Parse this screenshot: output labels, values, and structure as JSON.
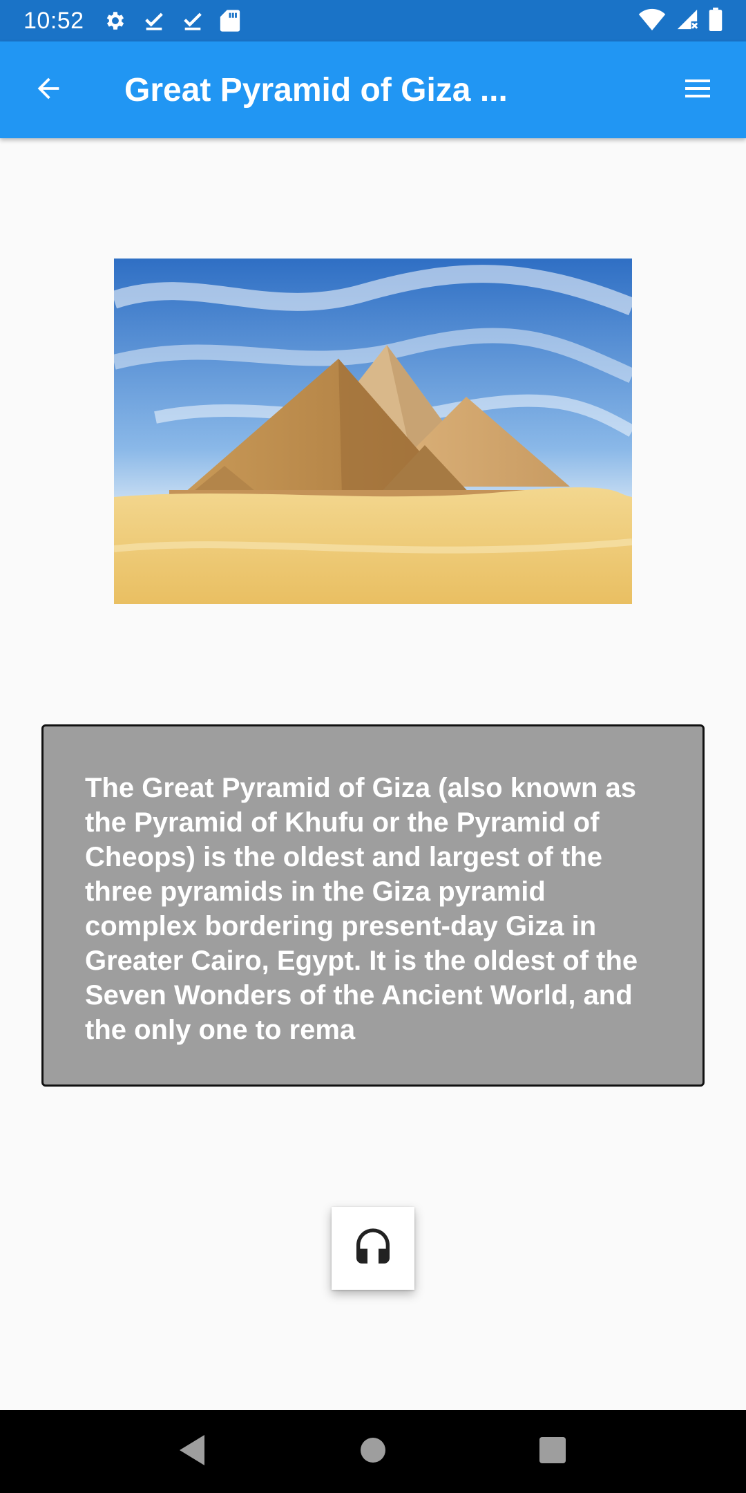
{
  "status_bar": {
    "time": "10:52",
    "left_icons": [
      "gear-icon",
      "download-done-icon",
      "download-done-icon",
      "sd-card-icon"
    ],
    "right_icons": [
      "wifi-icon",
      "signal-no-data-icon",
      "battery-icon"
    ],
    "background": "#1a73c7"
  },
  "app_bar": {
    "title": "Great Pyramid of Giza ...",
    "back_icon": "arrow-back-icon",
    "menu_icon": "menu-icon",
    "background": "#2196f3"
  },
  "hero_image": {
    "subject": "Pyramids of Giza in the desert under a blue sky"
  },
  "description": {
    "text": "The Great Pyramid of Giza (also known as the Pyramid of Khufu or the Pyramid of Cheops) is the oldest and largest of the three pyramids in the Giza pyramid complex bordering present-day Giza in Greater Cairo, Egypt. It is the oldest of the Seven Wonders of the Ancient World, and the only one to rema",
    "card_color": "#9e9e9e"
  },
  "audio_button": {
    "icon": "headphones-icon"
  },
  "nav_bar": {
    "icons": [
      "nav-back-icon",
      "nav-home-icon",
      "nav-recents-icon"
    ]
  }
}
